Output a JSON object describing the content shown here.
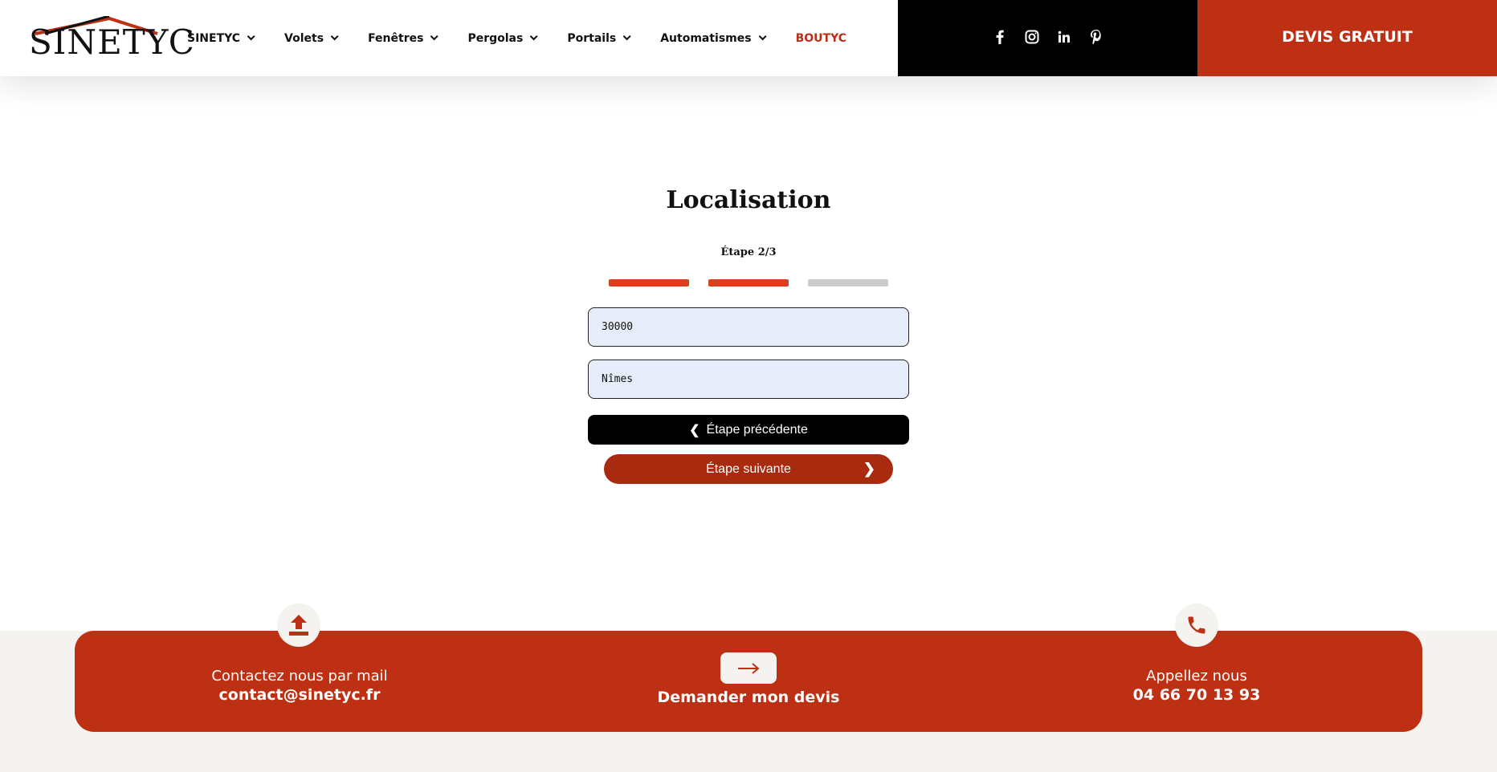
{
  "brand": {
    "logo_text": "SINETYC",
    "accent": "#bd3014",
    "dark_accent": "#a82a0f"
  },
  "nav": {
    "items": [
      {
        "label": "SINETYC",
        "dropdown": true
      },
      {
        "label": "Volets",
        "dropdown": true
      },
      {
        "label": "Fenêtres",
        "dropdown": true
      },
      {
        "label": "Pergolas",
        "dropdown": true
      },
      {
        "label": "Portails",
        "dropdown": true
      },
      {
        "label": "Automatismes",
        "dropdown": true
      },
      {
        "label": "BOUTYC",
        "dropdown": false
      }
    ]
  },
  "social": [
    "facebook-icon",
    "instagram-icon",
    "linkedin-icon",
    "pinterest-icon"
  ],
  "header_cta": "DEVIS GRATUIT",
  "form": {
    "title": "Localisation",
    "step_label": "Étape 2/3",
    "progress": {
      "current": 2,
      "total": 3,
      "active_color": "#d9401c",
      "inactive_color": "#cccccc"
    },
    "postal_code": "30000",
    "city": "Nîmes",
    "prev_label": "Étape précédente",
    "next_label": "Étape suivante"
  },
  "contact": {
    "mail_label": "Contactez nous par mail",
    "mail_value": "contact@sinetyc.fr",
    "devis_label": "Demander mon devis",
    "phone_label": "Appellez nous",
    "phone_value": "04 66 70 13 93"
  }
}
